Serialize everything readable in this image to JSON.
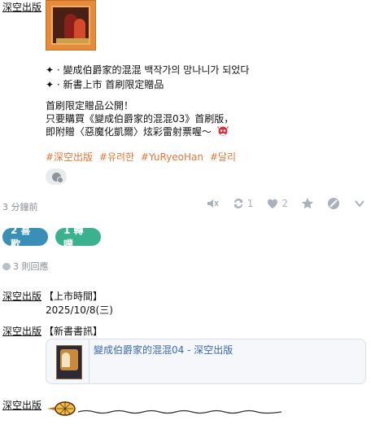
{
  "post": {
    "author": "深空出版",
    "lines": {
      "title_line_1": "✦ · 變成伯爵家的混混 백작가의 망나니가 되었다",
      "title_line_2": "✦ · 新書上市 首刷限定贈品",
      "body_1": "首刷限定贈品公開！",
      "body_2": "只要購買《變成伯爵家的混混03》首刷版，",
      "body_3": "即附贈〈惡魔化凱爾〉炫彩雷射票喔～"
    },
    "hashtags": [
      "#深空出版",
      "#유려한",
      "#YuRyeoHan",
      "#달리"
    ],
    "time_ago": "3 分鐘前",
    "toolbar": {
      "reblog_count": "1",
      "like_count": "2"
    },
    "stats": {
      "likes_label": "2 喜歡",
      "reblogs_label": "1 轉噗"
    },
    "reply_count_label": "3 則回應"
  },
  "replies": [
    {
      "author": "深空出版",
      "text_line_1": "【上市時間】",
      "text_line_2": "2025/10/8(三)"
    },
    {
      "author": "深空出版",
      "text_line_1": "【新書書訊】",
      "link_title": "變成伯爵家的混混04 - 深空出版"
    },
    {
      "author": "深空出版"
    }
  ],
  "colors": {
    "like_pill": "#3a8fb7",
    "reblog_pill": "#3bb28d",
    "hashtag": "#e0783a",
    "toolbar_icon": "#a9b2bc",
    "link_title": "#3b6aa8"
  }
}
